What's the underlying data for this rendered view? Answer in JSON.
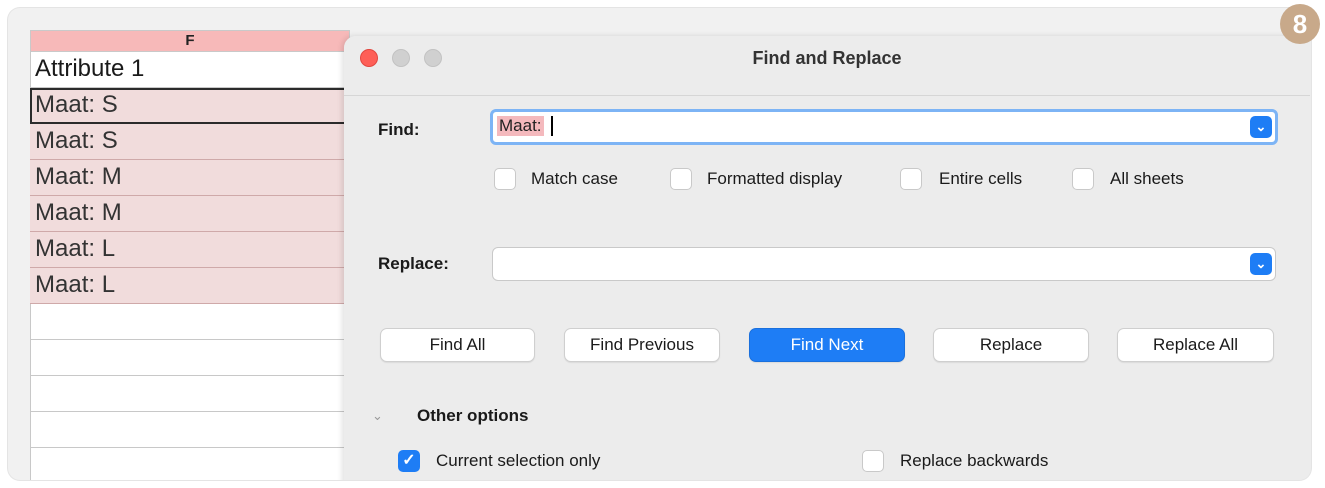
{
  "badge": "8",
  "sheet": {
    "column_header": "F",
    "cells": [
      "Attribute 1",
      "Maat: S",
      "Maat: S",
      "Maat: M",
      "Maat: M",
      "Maat: L",
      "Maat: L"
    ]
  },
  "dialog": {
    "title": "Find and Replace",
    "find": {
      "label": "Find:",
      "value": "Maat:"
    },
    "options": {
      "match_case": "Match case",
      "formatted_display": "Formatted display",
      "entire_cells": "Entire cells",
      "all_sheets": "All sheets"
    },
    "replace": {
      "label": "Replace:",
      "value": ""
    },
    "buttons": {
      "find_all": "Find All",
      "find_previous": "Find Previous",
      "find_next": "Find Next",
      "replace": "Replace",
      "replace_all": "Replace All"
    },
    "other_options": {
      "label": "Other options",
      "current_selection_only": "Current selection only",
      "current_selection_checked": true,
      "replace_backwards": "Replace backwards",
      "replace_backwards_checked": false
    }
  },
  "icons": {
    "close": "red-close-dot",
    "dropdown": "chevron-down-icon",
    "expander": "chevron-down-icon",
    "check": "checkmark-icon"
  },
  "colors": {
    "accent": "#1e7df5",
    "header_highlight": "#f7b9b9",
    "selection": "#f1dcdc",
    "badge": "#c8a98a"
  }
}
